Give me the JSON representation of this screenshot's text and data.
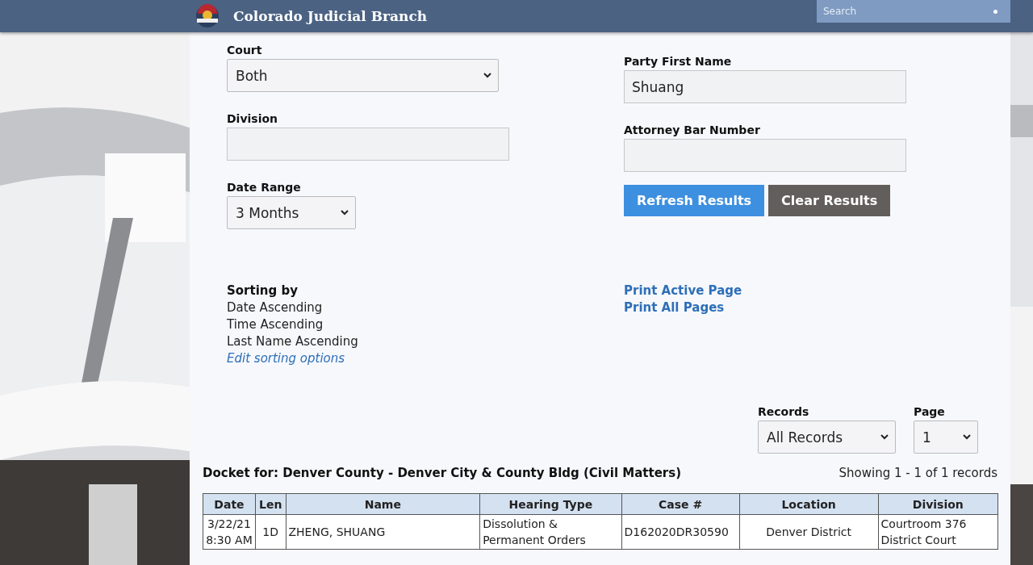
{
  "header": {
    "title": "Colorado Judicial Branch",
    "search": {
      "placeholder": "Search"
    }
  },
  "form": {
    "court": {
      "label": "Court",
      "value": "Both"
    },
    "division": {
      "label": "Division"
    },
    "date_range": {
      "label": "Date Range",
      "value": "3 Months"
    },
    "party_first_name": {
      "label": "Party First Name",
      "value": "Shuang"
    },
    "attorney_bar_number": {
      "label": "Attorney Bar Number"
    },
    "buttons": [
      {
        "label": "Refresh Results",
        "kind": "primary"
      },
      {
        "label": "Clear Results",
        "kind": "secondary"
      }
    ]
  },
  "sorting": {
    "title": "Sorting by",
    "lines": [
      "Date Ascending",
      "Time Ascending",
      "Last Name Ascending"
    ],
    "edit_link": "Edit sorting options"
  },
  "print_links": [
    "Print Active Page",
    "Print All Pages"
  ],
  "records": {
    "label": "Records",
    "value": "All Records"
  },
  "page": {
    "label": "Page",
    "value": "1"
  },
  "docket": {
    "title": "Docket for: Denver County - Denver City & County Bldg (Civil Matters)",
    "showing": "Showing 1 - 1 of 1 records"
  },
  "table": {
    "columns": [
      "Date",
      "Len",
      "Name",
      "Hearing Type",
      "Case #",
      "Location",
      "Division"
    ],
    "rows": [
      [
        [
          "3/22/21",
          "8:30 AM"
        ],
        [
          "1D"
        ],
        [
          "ZHENG, SHUANG"
        ],
        [
          "Dissolution &",
          "Permanent Orders"
        ],
        [
          "D162020DR30590"
        ],
        [
          "Denver District"
        ],
        [
          "Courtroom 376",
          "District Court"
        ]
      ]
    ]
  }
}
